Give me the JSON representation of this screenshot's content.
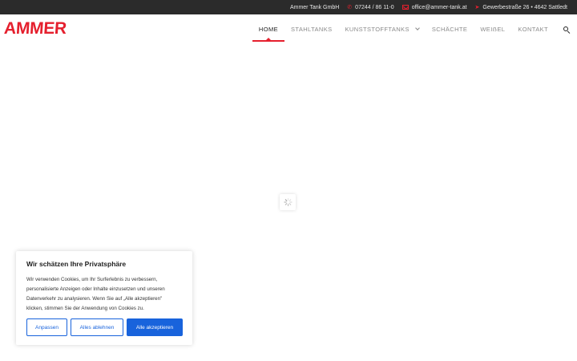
{
  "topbar": {
    "company": "Ammer Tank GmbH",
    "phone": "07244 / 86 11-0",
    "email": "office@ammer-tank.at",
    "address": "Gewerbestraße 26 • 4642 Sattledt",
    "icons": {
      "phone": "phone-icon",
      "email": "mail-icon",
      "address": "location-arrow-icon"
    },
    "accent_color": "#e5202e"
  },
  "header": {
    "logo": "AMMER",
    "nav": [
      {
        "label": "HOME",
        "active": true
      },
      {
        "label": "STAHLTANKS",
        "active": false
      },
      {
        "label": "KUNSTSTOFFTANKS",
        "active": false,
        "has_dropdown": true
      },
      {
        "label": "SCHÄCHTE",
        "active": false
      },
      {
        "label": "WEIẞEL",
        "active": false
      },
      {
        "label": "KONTAKT",
        "active": false
      }
    ],
    "search_icon": "search-icon"
  },
  "loader": {
    "icon": "spinner-icon"
  },
  "cookie": {
    "title": "Wir schätzen Ihre Privatsphäre",
    "lines": [
      "Wir verwenden Cookies, um Ihr Surferlebnis zu verbessern,",
      "personalisierte Anzeigen oder Inhalte einzusetzen und unseren",
      "Datenverkehr zu analysieren. Wenn Sie auf „Alle akzeptieren\"",
      "klicken, stimmen Sie der Anwendung von Cookies zu."
    ],
    "buttons": {
      "customize": "Anpassen",
      "reject": "Alles ablehnen",
      "accept": "Alle akzeptieren"
    },
    "button_color": "#1863dc"
  }
}
